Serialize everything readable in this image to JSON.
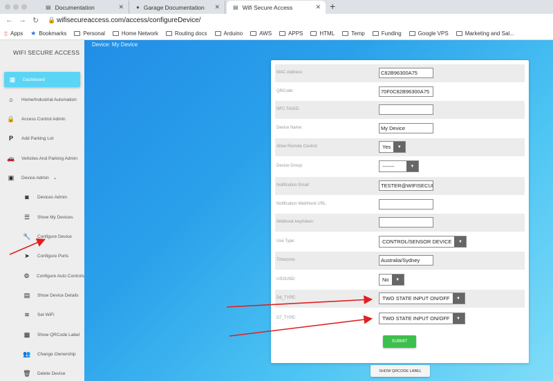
{
  "browser": {
    "tabs": [
      {
        "title": "Documentation",
        "active": false
      },
      {
        "title": "Garage Documentation",
        "active": false
      },
      {
        "title": "Wifi Secure Access",
        "active": true
      }
    ],
    "url": "wifisecureaccess.com/access/configureDevice/",
    "bookmarks": [
      "Apps",
      "Bookmarks",
      "Personal",
      "Home Network",
      "Routing docs",
      "Arduino",
      "AWS",
      "APPS",
      "HTML",
      "Temp",
      "Funding",
      "Google VPS",
      "Marketing and Sal..."
    ]
  },
  "sidebar": {
    "brand": "WIFI SECURE ACCESS",
    "items": [
      {
        "label": "Dashboard",
        "icon": "dashboard-icon"
      },
      {
        "label": "Home/Industrial Automation",
        "icon": "home-icon"
      },
      {
        "label": "Access Control Admin",
        "icon": "lock-icon"
      },
      {
        "label": "Add Parking Lot",
        "icon": "parking-icon"
      },
      {
        "label": "Vehicles And Parking Admin",
        "icon": "car-icon"
      },
      {
        "label": "Device Admin",
        "icon": "device-icon"
      },
      {
        "label": "Devices Admin",
        "icon": "devices-icon"
      },
      {
        "label": "Show My Devices",
        "icon": "list-icon"
      },
      {
        "label": "Configure Device",
        "icon": "wrench-icon"
      },
      {
        "label": "Configure Ports",
        "icon": "ports-icon"
      },
      {
        "label": "Configure Auto Controls",
        "icon": "gear-icon"
      },
      {
        "label": "Show Device Details",
        "icon": "details-icon"
      },
      {
        "label": "Set WiFi",
        "icon": "wifi-icon"
      },
      {
        "label": "Show QRCode Label",
        "icon": "qrcode-icon"
      },
      {
        "label": "Change Ownership",
        "icon": "users-icon"
      },
      {
        "label": "Delete Device",
        "icon": "trash-icon"
      }
    ]
  },
  "main": {
    "title": "Device: My Device",
    "form": {
      "mac_label": "MAC Address:",
      "mac_value": "C82B96300A75",
      "qr_label": "QRCode:",
      "qr_value": "70F0C82B96300A75",
      "nfc_label": "NFC TAGID:",
      "nfc_value": "",
      "name_label": "Device Name:",
      "name_value": "My Device",
      "remote_label": "Allow Remote Control:",
      "remote_value": "Yes",
      "group_label": "Device Group:",
      "group_value": "-------",
      "email_label": "Notification Email:",
      "email_value": "TESTER@WIFISECUREACCESS.COM",
      "webhook_label": "Notification WebHook URL:",
      "webhook_value": "",
      "key_label": "Webhook key/token:",
      "key_value": "",
      "usetype_label": "Use Type:",
      "usetype_value": "CONTROL/SENSOR DEVICE",
      "tz_label": "Timezone:",
      "tz_value": "Australia/Sydney",
      "usound_label": "USOUND:",
      "usound_value": "No",
      "d6_label": "D6_TYPE:",
      "d6_value": "TWO STATE INPUT ON/OFF",
      "d7_label": "D7_TYPE:",
      "d7_value": "TWO STATE INPUT ON/OFF",
      "submit_label": "SUBMIT"
    },
    "qr_button_label": "SHOW QRCODE LABEL"
  },
  "colors": {
    "accent": "#5bd5f5",
    "submit": "#3cbf4c",
    "annotation_arrow": "#e02020"
  }
}
